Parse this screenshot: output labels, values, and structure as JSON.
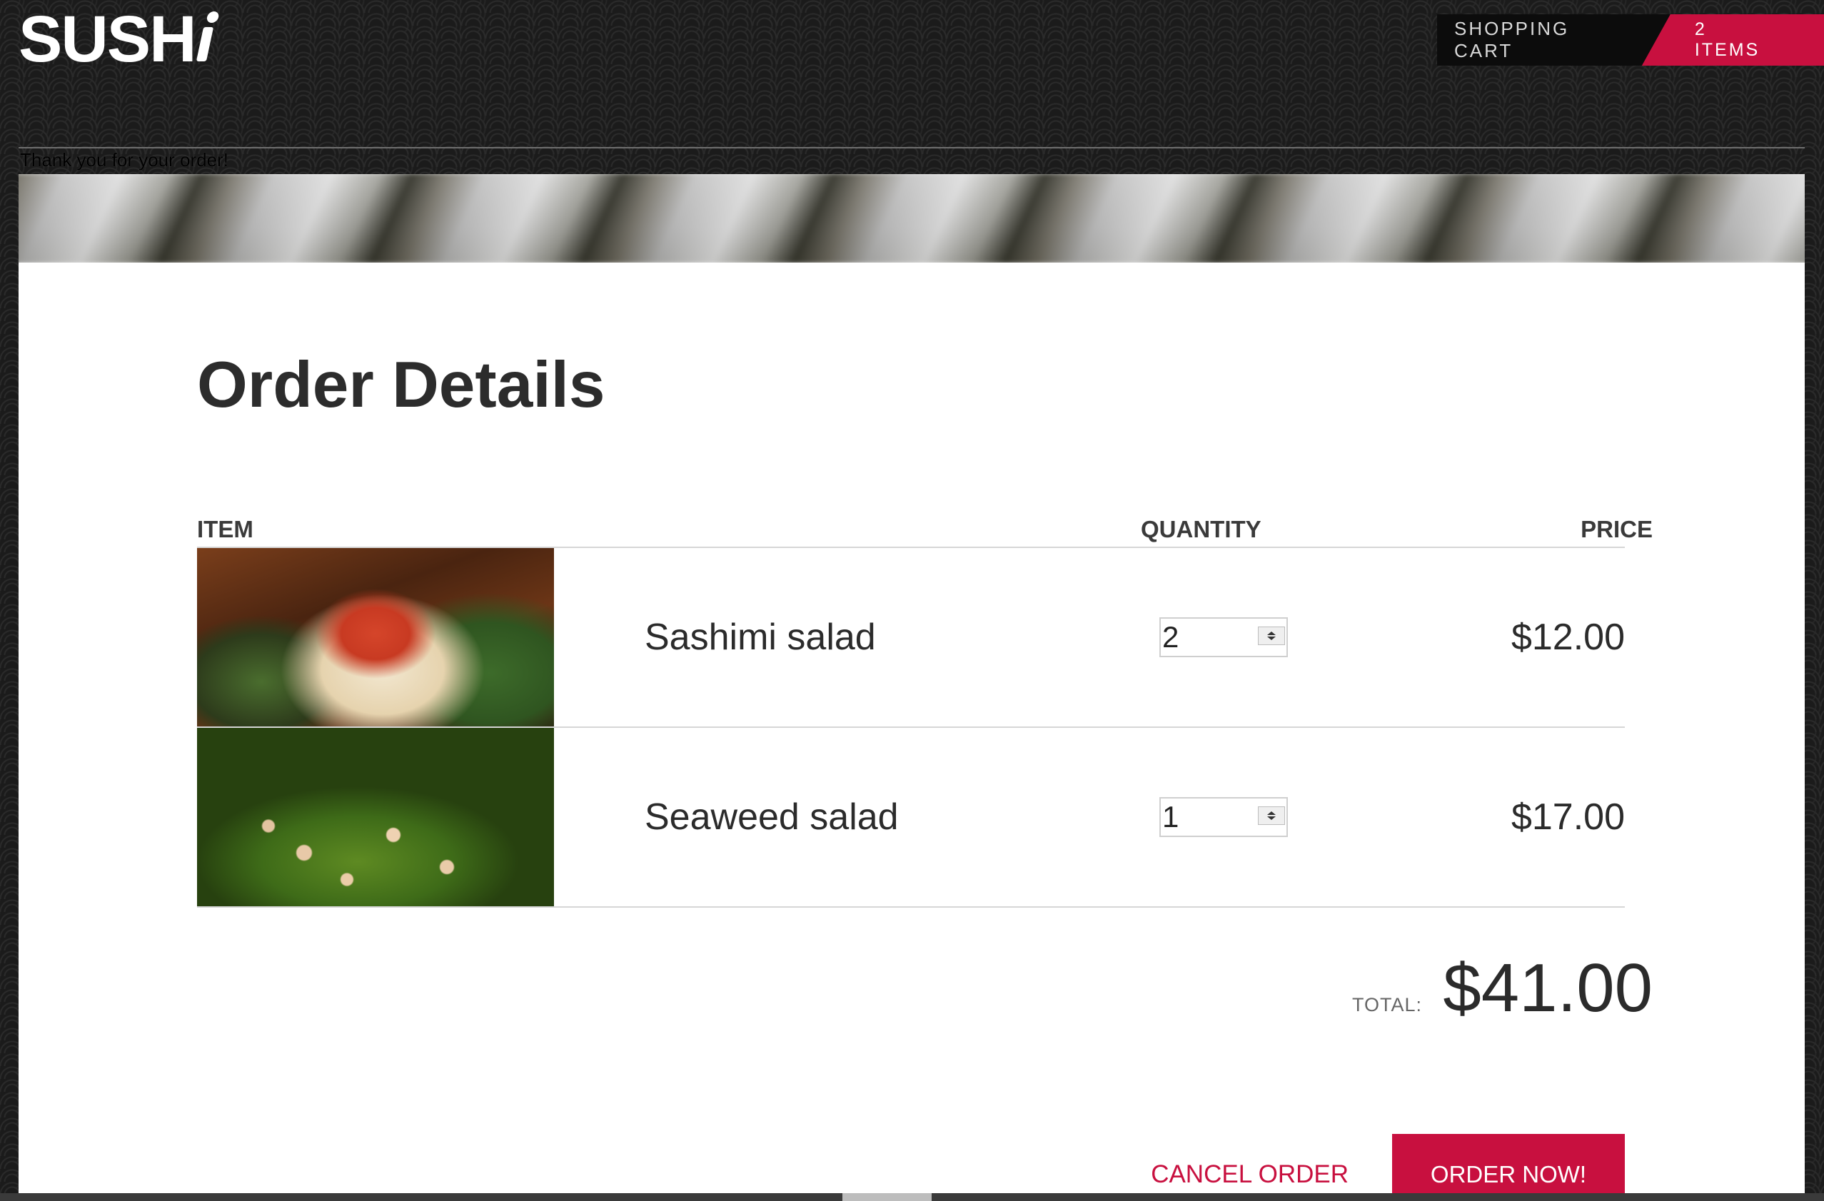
{
  "brand": {
    "logo_text": "SUSH"
  },
  "cart": {
    "label": "SHOPPING CART",
    "count_label": "2 ITEMS"
  },
  "message": "Thank you for your order!",
  "page_title": "Order Details",
  "table": {
    "headers": {
      "item": "ITEM",
      "quantity": "QUANTITY",
      "price": "PRICE"
    },
    "rows": [
      {
        "name": "Sashimi salad",
        "quantity": "2",
        "price": "$12.00",
        "image": "sashimi-salad-photo"
      },
      {
        "name": "Seaweed salad",
        "quantity": "1",
        "price": "$17.00",
        "image": "seaweed-salad-photo"
      }
    ]
  },
  "total": {
    "label": "TOTAL:",
    "value": "$41.00"
  },
  "actions": {
    "cancel_label": "CANCEL ORDER",
    "order_label": "ORDER NOW!"
  },
  "colors": {
    "accent": "#c8103f",
    "background": "#1b1b1b",
    "panel": "#ffffff",
    "text": "#2b2b2b"
  }
}
